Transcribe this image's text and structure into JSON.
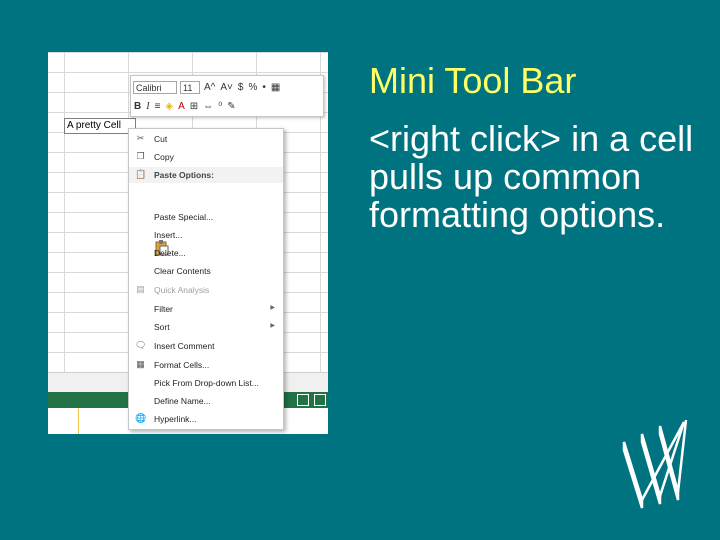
{
  "slide": {
    "title": "Mini Tool Bar",
    "body": "<right click> in a cell pulls up common formatting options."
  },
  "colors": {
    "background": "#007380",
    "title": "#ffff66",
    "body": "#ffffff",
    "excel_green": "#217346"
  },
  "spreadsheet": {
    "cell_text": "A pretty Cell"
  },
  "mini_toolbar": {
    "font": "Calibri",
    "size": "11",
    "row1": [
      "A^",
      "A˅",
      "$",
      "%",
      "•"
    ],
    "row2": [
      "B",
      "I"
    ]
  },
  "context_menu": {
    "items": [
      {
        "label": "Cut",
        "icon": "scissors-icon"
      },
      {
        "label": "Copy",
        "icon": "copy-icon"
      },
      {
        "label": "Paste Options:",
        "icon": "paste-icon",
        "header": true
      },
      {
        "label": "Paste Special...",
        "icon": ""
      },
      {
        "label": "Insert...",
        "icon": ""
      },
      {
        "label": "Delete...",
        "icon": ""
      },
      {
        "label": "Clear Contents",
        "icon": ""
      },
      {
        "label": "Quick Analysis",
        "icon": "quick-analysis-icon",
        "disabled": true
      },
      {
        "label": "Filter",
        "icon": "",
        "submenu": true
      },
      {
        "label": "Sort",
        "icon": "",
        "submenu": true
      },
      {
        "label": "Insert Comment",
        "icon": "comment-icon"
      },
      {
        "label": "Format Cells...",
        "icon": "format-cells-icon"
      },
      {
        "label": "Pick From Drop-down List...",
        "icon": ""
      },
      {
        "label": "Define Name...",
        "icon": ""
      },
      {
        "label": "Hyperlink...",
        "icon": "hyperlink-icon"
      }
    ]
  }
}
